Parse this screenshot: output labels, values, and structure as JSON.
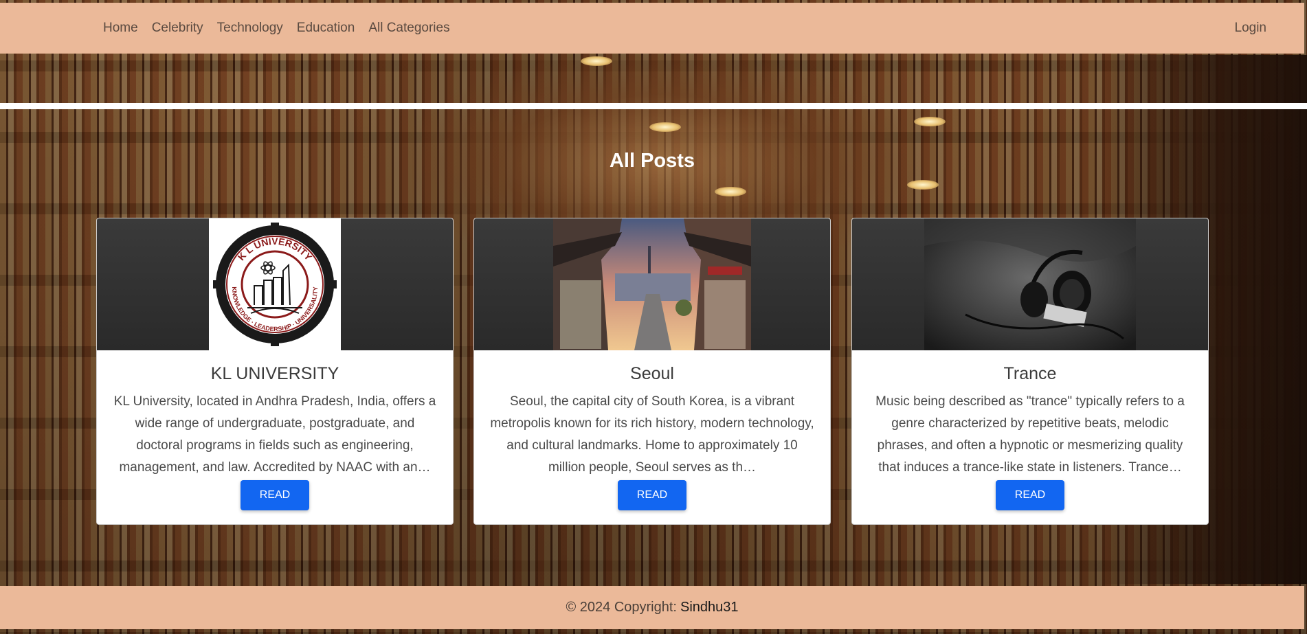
{
  "nav": {
    "links": [
      "Home",
      "Celebrity",
      "Technology",
      "Education",
      "All Categories"
    ],
    "login": "Login"
  },
  "main": {
    "title": "All Posts"
  },
  "posts": [
    {
      "title": "KL UNIVERSITY",
      "excerpt": "KL University, located in Andhra Pradesh, India, offers a wide range of undergraduate, postgraduate, and doctoral programs in fields such as engineering, management, and law. Accredited by NAAC with an…",
      "button": "READ",
      "logo": {
        "top_text": "K L UNIVERSITY",
        "bottom_text": "KNOWLEDGE · LEADERSHIP · UNIVERSALITY"
      }
    },
    {
      "title": "Seoul",
      "excerpt": "Seoul, the capital city of South Korea, is a vibrant metropolis known for its rich history, modern technology, and cultural landmarks. Home to approximately 10 million people, Seoul serves as th…",
      "button": "READ"
    },
    {
      "title": "Trance",
      "excerpt": "Music being described as \"trance\" typically refers to a genre characterized by repetitive beats, melodic phrases, and often a hypnotic or mesmerizing quality that induces a trance-like state in listeners. Trance…",
      "button": "READ"
    }
  ],
  "footer": {
    "copyright": "© 2024 Copyright:",
    "author": "Sindhu31"
  },
  "colors": {
    "nav_bg": "#ebb999",
    "button": "#1266f1",
    "title": "#ffffff"
  }
}
